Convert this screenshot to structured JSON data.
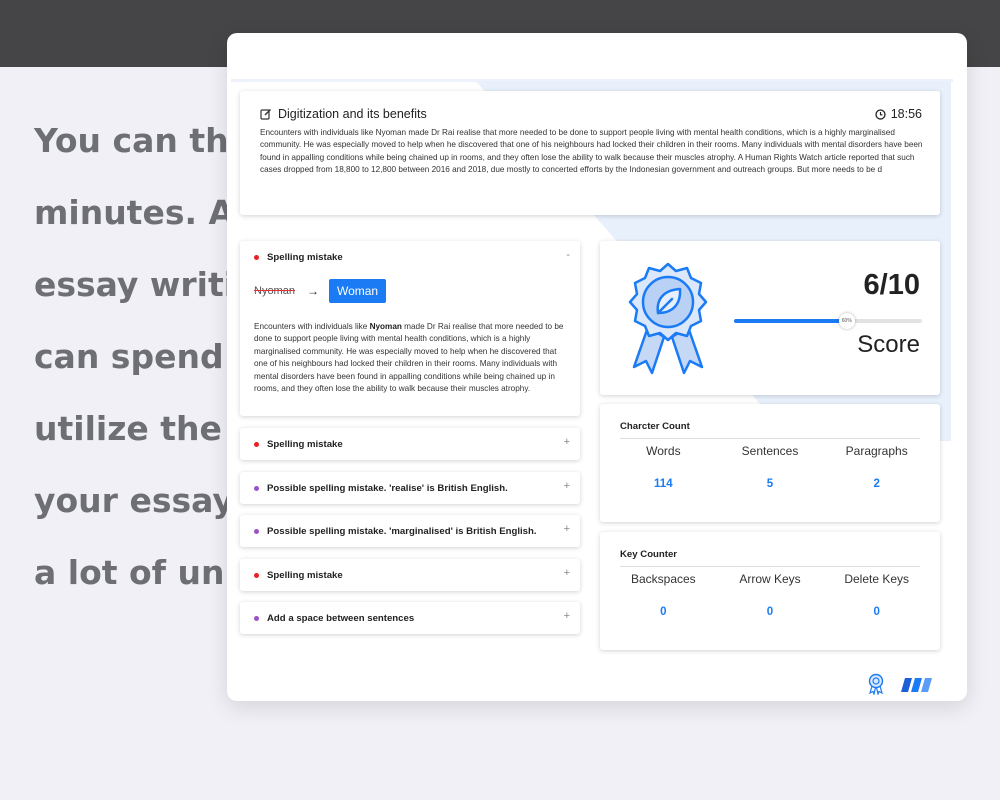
{
  "background": {
    "lines": [
      "You can thin",
      "minutes. Aft",
      "essay writin",
      "can spend a",
      "utilize the la",
      "your essay. T",
      "a lot of unne"
    ]
  },
  "essay": {
    "title": "Digitization and its benefits",
    "title_icon": "edit-icon",
    "timer": "18:56",
    "timer_icon": "clock-icon",
    "text": "Encounters with individuals like Nyoman made Dr Rai realise that more needed to be done to support people living with mental health conditions, which is a highly marginalised community. He was especially moved to help when he discovered that one of his neighbours had locked their children in their rooms. Many individuals with mental disorders have been found in appalling conditions while being chained up in rooms, and they often lose the ability to walk because their muscles atrophy. A Human Rights Watch article reported that such cases dropped from 18,800 to 12,800 between 2016 and 2018, due mostly to concerted efforts by the Indonesian government and outreach groups. But more needs to be d"
  },
  "mistakes": [
    {
      "title": "Spelling mistake",
      "dot": "#e82024",
      "toggle": "-",
      "expanded": true,
      "wrong": "Nyoman",
      "arrow": "→",
      "suggestion": "Woman",
      "body_pre": "Encounters with individuals like ",
      "body_bold": "Nyoman",
      "body_post": " made Dr Rai realise that more needed to be done to support people living with mental health conditions, which is a highly marginalised community. He was especially moved to help when he discovered that one of his neighbours had locked their children in their rooms. Many individuals with mental disorders have been found in appalling conditions while being chained up in rooms, and they often lose the ability to walk because their muscles atrophy."
    },
    {
      "title": "Spelling mistake",
      "dot": "#e82024",
      "toggle": "+"
    },
    {
      "title": "Possible spelling mistake. 'realise' is British English.",
      "dot": "#9a52c8",
      "toggle": "+"
    },
    {
      "title": "Possible spelling mistake. 'marginalised' is British English.",
      "dot": "#9a52c8",
      "toggle": "+"
    },
    {
      "title": "Spelling mistake",
      "dot": "#e82024",
      "toggle": "+"
    },
    {
      "title": "Add a space between sentences",
      "dot": "#9a52c8",
      "toggle": "+"
    }
  ],
  "score": {
    "value": "6/10",
    "label": "Score",
    "progress_percent": 60,
    "progress_label": "60%",
    "badge_icon": "award-ribbon-icon"
  },
  "character_count": {
    "title": "Charcter Count",
    "columns": [
      {
        "label": "Words",
        "value": "114"
      },
      {
        "label": "Sentences",
        "value": "5"
      },
      {
        "label": "Paragraphs",
        "value": "2"
      }
    ]
  },
  "key_counter": {
    "title": "Key Counter",
    "columns": [
      {
        "label": "Backspaces",
        "value": "0"
      },
      {
        "label": "Arrow Keys",
        "value": "0"
      },
      {
        "label": "Delete Keys",
        "value": "0"
      }
    ]
  },
  "footer": {
    "icons": [
      "award-small-icon",
      "brand-logo-icon"
    ]
  },
  "colors": {
    "accent": "#1a7bf5",
    "error": "#e82024",
    "warning": "#9a52c8",
    "topbar": "#454547"
  }
}
